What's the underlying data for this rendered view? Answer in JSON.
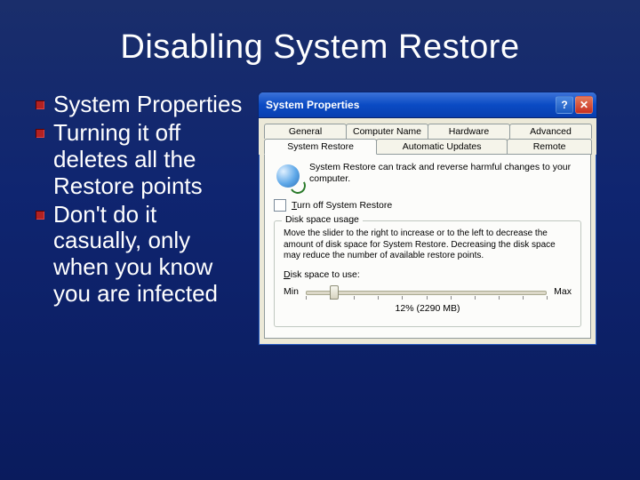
{
  "slide": {
    "title": "Disabling System Restore",
    "bullets": [
      "System Properties",
      "Turning it off deletes all the Restore points",
      "Don't do it casually, only when you know you are infected"
    ]
  },
  "window": {
    "title": "System Properties",
    "help_symbol": "?",
    "close_symbol": "✕",
    "tabs_row1": [
      "General",
      "Computer Name",
      "Hardware",
      "Advanced"
    ],
    "tabs_row2": [
      "System Restore",
      "Automatic Updates",
      "Remote"
    ],
    "active_tab": "System Restore",
    "intro": "System Restore can track and reverse harmful changes to your computer.",
    "checkbox_label": "Turn off System Restore",
    "groupbox": {
      "title": "Disk space usage",
      "desc": "Move the slider to the right to increase or to the left to decrease the amount of disk space for System Restore. Decreasing the disk space may reduce the number of available restore points.",
      "slider_label": "Disk space to use:",
      "min": "Min",
      "max": "Max",
      "value": "12% (2290 MB)"
    }
  }
}
